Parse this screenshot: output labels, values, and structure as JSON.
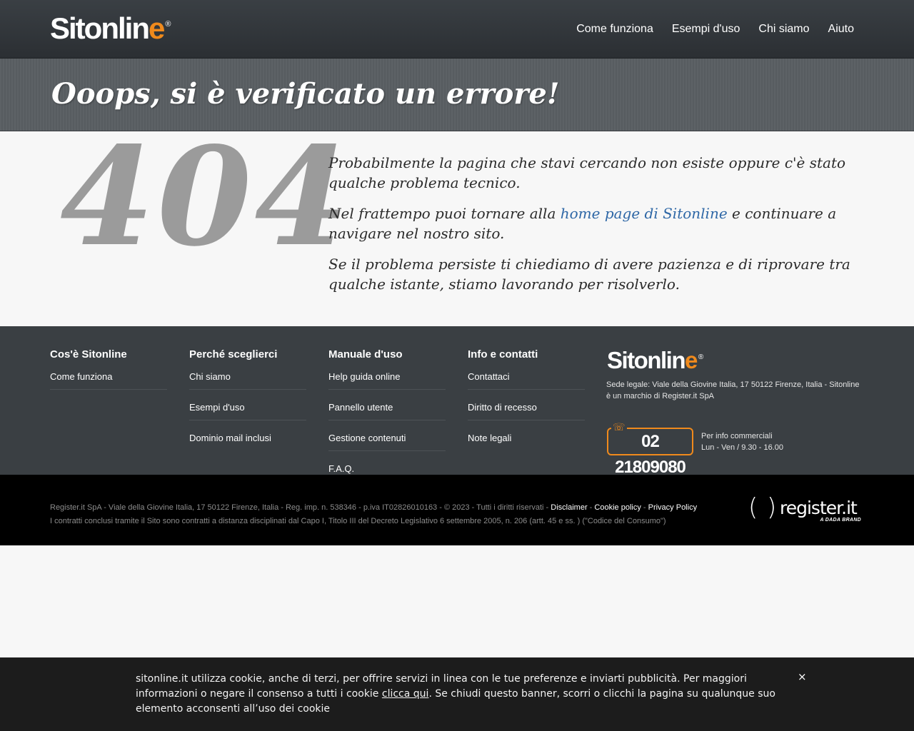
{
  "header": {
    "logo": {
      "text": "Sitonlin",
      "accent": "e",
      "reg": "®"
    },
    "nav": [
      {
        "label": "Come funziona"
      },
      {
        "label": "Esempi d'uso"
      },
      {
        "label": "Chi siamo"
      },
      {
        "label": "Aiuto"
      }
    ]
  },
  "title_band": {
    "title": "Ooops, si è verificato un errore!"
  },
  "main": {
    "code": "404",
    "p1": "Probabilmente la pagina che stavi cercando non esiste oppure c'è stato qualche problema tecnico.",
    "p2_before": "Nel frattempo puoi tornare alla ",
    "p2_link": "home page di Sitonline",
    "p2_after": " e continuare a navigare nel nostro sito.",
    "p3": "Se il problema persiste ti chiediamo di avere pazienza e di riprovare tra qualche istante, stiamo lavorando per risolverlo."
  },
  "footer": {
    "columns": [
      {
        "title": "Cos'è Sitonline",
        "items": [
          "Come funziona"
        ]
      },
      {
        "title": "Perché sceglierci",
        "items": [
          "Chi siamo",
          "Esempi d'uso",
          "Dominio mail inclusi"
        ]
      },
      {
        "title": "Manuale d'uso",
        "items": [
          "Help guida online",
          "Pannello utente",
          "Gestione contenuti",
          "F.A.Q."
        ]
      },
      {
        "title": "Info e contatti",
        "items": [
          "Contattaci",
          "Diritto di recesso",
          "Note legali"
        ]
      }
    ],
    "logo": {
      "text": "Sitonlin",
      "accent": "e",
      "reg": "®"
    },
    "sede": "Sede legale: Viale della Giovine Italia, 17 50122 Firenze, Italia - Sitonline è un marchio di Register.it SpA",
    "phone": "02 21809080",
    "phone_info_1": "Per info commerciali",
    "phone_info_2": "Lun - Ven / 9.30 - 16.00"
  },
  "bottom": {
    "legal_1": "Register.it SpA - Viale della Giovine Italia, 17 50122 Firenze, Italia - Reg. imp. n. 538346 - p.iva IT02826010163 - © 2023 - Tutti i diritti riservati - ",
    "disclaimer": "Disclaimer",
    "sep": " - ",
    "cookie_policy": "Cookie policy",
    "privacy_policy": "Privacy Policy",
    "legal_2": "I contratti conclusi tramite il Sito sono contratti a distanza disciplinati dal Capo I, Titolo III del Decreto Legislativo 6 settembre 2005, n. 206 (artt. 45 e ss. ) (\"Codice del Consumo\")",
    "register_logo": {
      "left": "(",
      "right": ")",
      "word": "register.it",
      "tag": "A DADA BRAND"
    }
  },
  "cookie": {
    "text_before": "sitonline.it utilizza cookie, anche di terzi, per offrire servizi in linea con le tue preferenze e inviarti pubblicità. Per maggiori informazioni o negare il consenso a tutti i cookie ",
    "link": "clicca qui",
    "text_after": ". Se chiudi questo banner, scorri o clicchi la pagina su qualunque suo elemento acconsenti all’uso dei cookie",
    "close": "×"
  },
  "colors": {
    "accent_orange": "#f08a1c",
    "link_blue": "#2e67a6",
    "header_dark": "#2f3337",
    "footer_gray": "#3a3f43"
  }
}
